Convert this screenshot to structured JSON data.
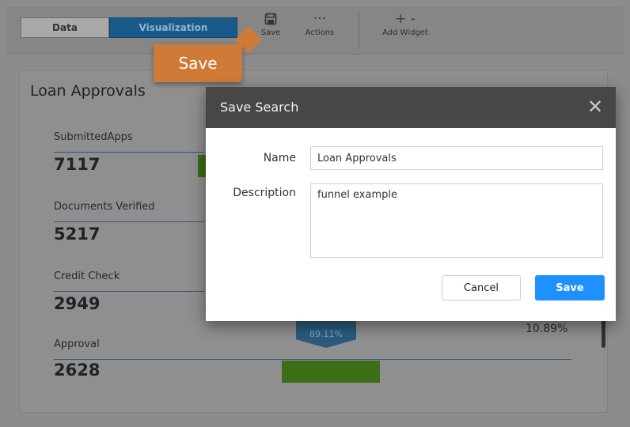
{
  "toolbar": {
    "tabs": [
      {
        "label": "Data"
      },
      {
        "label": "Visualization"
      }
    ],
    "tools": {
      "save": {
        "label": "Save",
        "icon": "floppy-disk-icon"
      },
      "actions": {
        "label": "Actions",
        "icon": "ellipsis-icon"
      },
      "add_widget": {
        "label": "Add Widget",
        "icon": "plus-minus-icon"
      }
    }
  },
  "callout": {
    "label": "Save"
  },
  "panel": {
    "title": "Loan Approvals",
    "metrics": [
      {
        "label": "SubmittedApps",
        "value": "7117"
      },
      {
        "label": "Documents Verified",
        "value": "5217"
      },
      {
        "label": "Credit Check",
        "value": "2949"
      },
      {
        "label": "Approval",
        "value": "2628"
      }
    ],
    "funnel_percent": "89.11%",
    "drop_percent": "10.89%"
  },
  "modal": {
    "title": "Save Search",
    "close_glyph": "✕",
    "fields": {
      "name_label": "Name",
      "name_value": "Loan Approvals",
      "description_label": "Description",
      "description_value": "funnel example"
    },
    "buttons": {
      "cancel": "Cancel",
      "save": "Save"
    }
  },
  "colors": {
    "accent": "#1e90ff",
    "callout": "#d07a38",
    "modal_header": "#474747",
    "funnel_green": "#3b6e16"
  }
}
